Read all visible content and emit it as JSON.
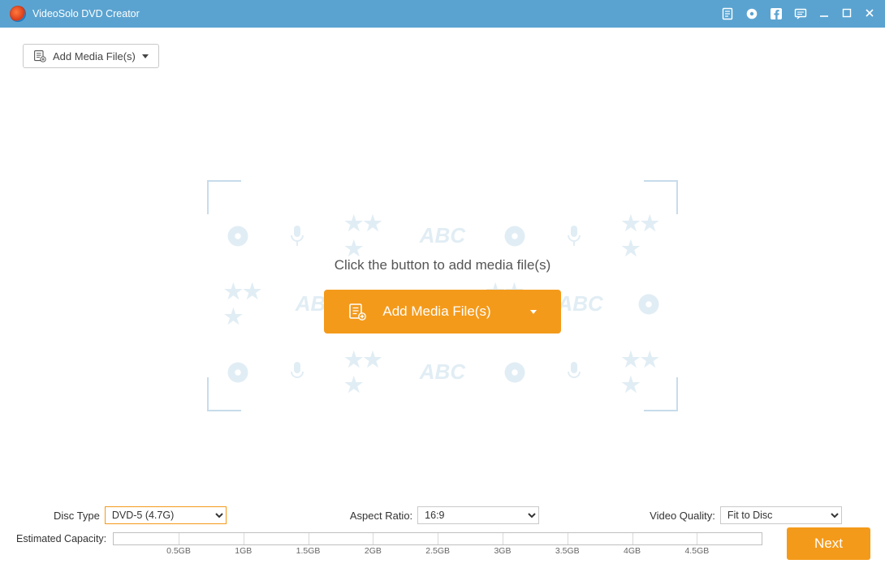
{
  "titlebar": {
    "title": "VideoSolo DVD Creator"
  },
  "toolbar": {
    "add_media_label": "Add Media File(s)"
  },
  "dropzone": {
    "hint": "Click the button to add media file(s)",
    "add_media_label": "Add Media File(s)"
  },
  "settings": {
    "disc_type_label": "Disc Type",
    "disc_type_selected": "DVD-5 (4.7G)",
    "aspect_ratio_label": "Aspect Ratio:",
    "aspect_ratio_selected": "16:9",
    "video_quality_label": "Video Quality:",
    "video_quality_selected": "Fit to Disc"
  },
  "capacity": {
    "label": "Estimated Capacity:",
    "ticks": [
      "0.5GB",
      "1GB",
      "1.5GB",
      "2GB",
      "2.5GB",
      "3GB",
      "3.5GB",
      "4GB",
      "4.5GB"
    ]
  },
  "footer": {
    "next_label": "Next"
  }
}
